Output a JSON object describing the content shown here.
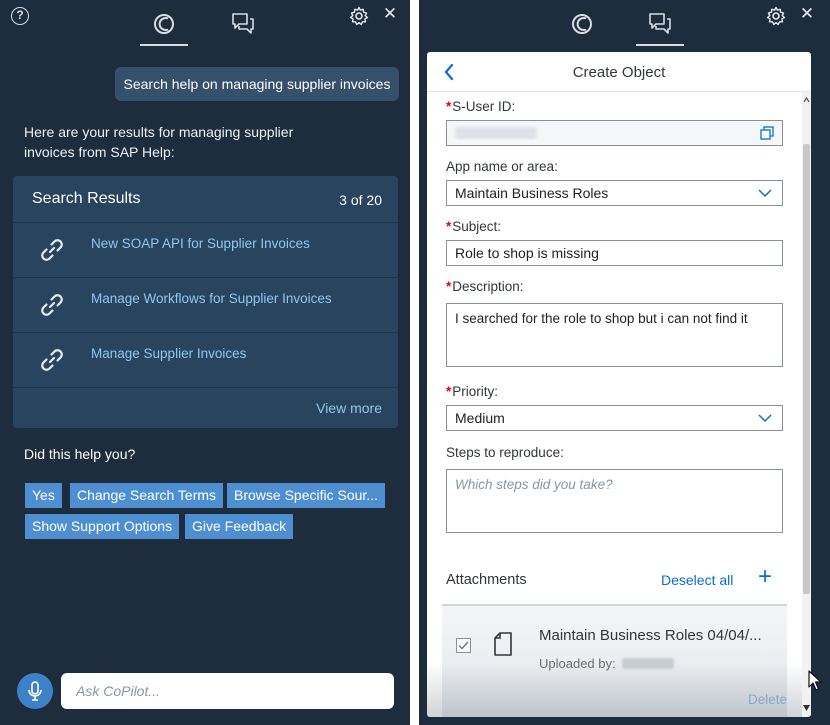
{
  "left_panel": {
    "user_message": "Search help on managing supplier invoices",
    "bot_message": "Here are your results for managing supplier invoices from SAP Help:",
    "search_results": {
      "title": "Search Results",
      "count": "3 of 20",
      "items": [
        {
          "label": "New SOAP API for Supplier Invoices",
          "icon": "link-icon"
        },
        {
          "label": "Manage Workflows for Supplier Invoices",
          "icon": "link-icon"
        },
        {
          "label": "Manage Supplier Invoices",
          "icon": "link-icon"
        }
      ],
      "view_more": "View more"
    },
    "feedback_question": "Did this help you?",
    "quick_replies": [
      "Yes",
      "Change Search Terms",
      "Browse Specific Sour...",
      "Show Support Options",
      "Give Feedback"
    ],
    "ask_placeholder": "Ask CoPilot...",
    "icons": [
      "help-icon",
      "copilot-icon",
      "chat-icon",
      "gear-icon",
      "close-icon",
      "microphone-icon"
    ]
  },
  "right_panel": {
    "title": "Create Object",
    "fields": {
      "s_user_id": {
        "label": "S-User ID:",
        "required": "*"
      },
      "app_area": {
        "label": "App name or area:",
        "value": "Maintain Business Roles"
      },
      "subject": {
        "label": "Subject:",
        "required": "*",
        "value": "Role to shop is missing"
      },
      "description": {
        "label": "Description:",
        "required": "*",
        "value": "I searched for the role to shop but i can not find it"
      },
      "priority": {
        "label": "Priority:",
        "required": "*",
        "value": "Medium"
      },
      "steps": {
        "label": "Steps to reproduce:",
        "placeholder": "Which steps did you take?"
      }
    },
    "attachments": {
      "label": "Attachments",
      "deselect_all": "Deselect all",
      "add": "+",
      "item_name": "Maintain Business Roles 04/04/...",
      "item_uploaded": "Uploaded by:"
    },
    "delete_label": "Delete"
  },
  "colors": {
    "panel_bg": "#1d2d3e",
    "results_bg": "#29445e",
    "link": "#8fc7f3",
    "button": "#4d8fd1",
    "required": "#ee0000",
    "sap_blue": "#0a6ed1"
  }
}
